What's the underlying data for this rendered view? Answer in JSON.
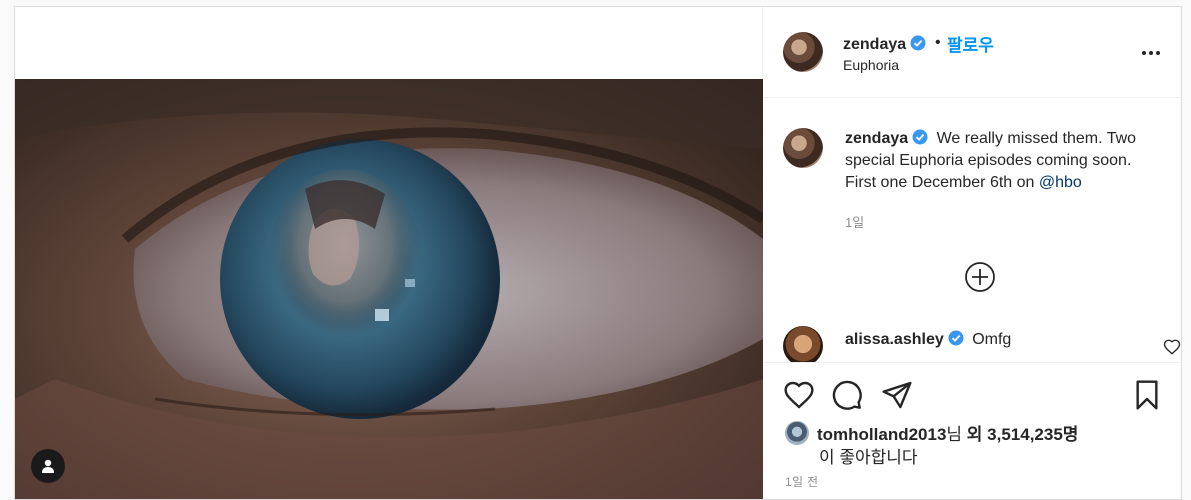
{
  "header": {
    "username": "zendaya",
    "separator": "•",
    "follow_label": "팔로우",
    "location": "Euphoria"
  },
  "caption": {
    "username": "zendaya",
    "text": "We really missed them. Two special Euphoria episodes coming soon. First one December 6th on",
    "mention": "@hbo",
    "time": "1일"
  },
  "comments": [
    {
      "username": "alissa.ashley",
      "text": "Omfg"
    }
  ],
  "likes": {
    "user": "tomholland2013",
    "suffix_nim": "님",
    "and_label": "외",
    "count": "3,514,235명",
    "line2": "이 좋아합니다"
  },
  "post_time": "1일 전",
  "icons": {
    "verified": "verified-badge-icon",
    "more": "more-options-icon",
    "load_more": "plus-circle-icon",
    "like": "heart-icon",
    "comment": "comment-bubble-icon",
    "share": "paper-plane-icon",
    "save": "bookmark-icon",
    "tag": "user-tag-icon"
  },
  "colors": {
    "accent": "#0095f6",
    "verified": "#3897f0",
    "mention": "#00376b",
    "muted": "#8e8e8e"
  }
}
